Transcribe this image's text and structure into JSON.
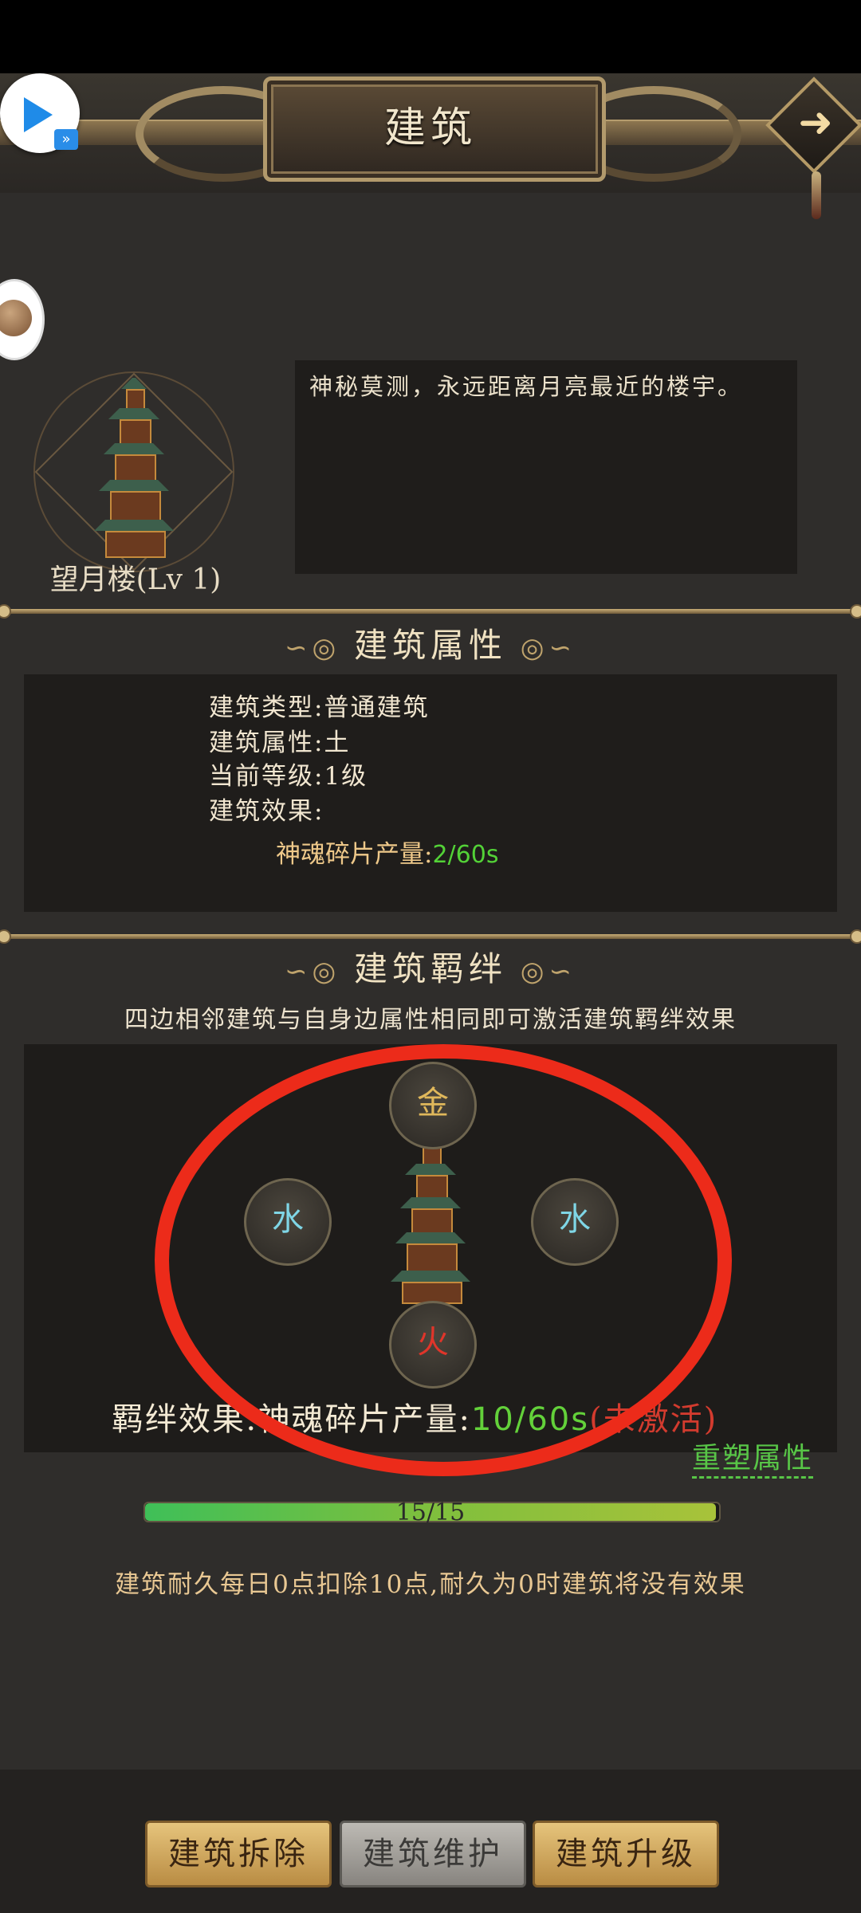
{
  "header": {
    "title": "建筑",
    "next_icon": "arrow-right-icon"
  },
  "building": {
    "name": "望月楼(Lv 1)",
    "description": "神秘莫测，永远距离月亮最近的楼宇。"
  },
  "attributes": {
    "section_title": "建筑属性",
    "type": "建筑类型:普通建筑",
    "element": "建筑属性:土",
    "level": "当前等级:1级",
    "effect_label": "建筑效果:",
    "production_label": "神魂碎片产量:",
    "production_value": "2/60s"
  },
  "bond": {
    "section_title": "建筑羁绊",
    "hint": "四边相邻建筑与自身边属性相同即可激活建筑羁绊效果",
    "top": "金",
    "left": "水",
    "right": "水",
    "bottom": "火",
    "effect_label": "羁绊效果:神魂碎片产量:",
    "effect_value": "10/60s",
    "effect_status": "(未激活)",
    "reshape": "重塑属性"
  },
  "durability": {
    "progress_text": "15/15",
    "progress_fraction": 1.0,
    "note": "建筑耐久每日0点扣除10点,耐久为0时建筑将没有效果"
  },
  "actions": {
    "demolish": "建筑拆除",
    "maintain": "建筑维护",
    "upgrade": "建筑升级"
  },
  "colors": {
    "accent_green": "#53d237",
    "inactive_red": "#d33b2e",
    "annotation_red": "#ec2b1a"
  }
}
